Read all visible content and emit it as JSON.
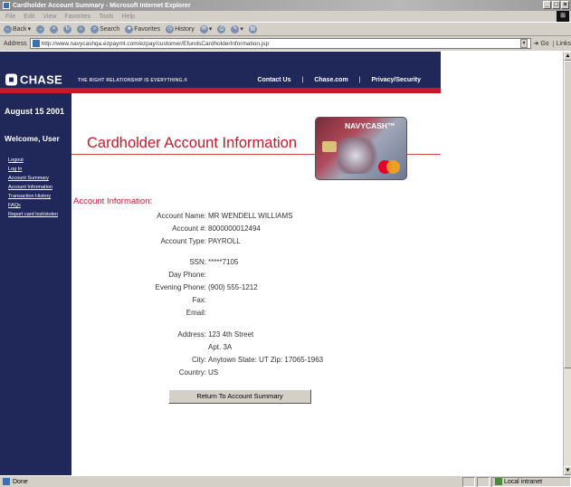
{
  "browser": {
    "title": "Cardholder Account Summary - Microsoft Internet Explorer",
    "menu": [
      "File",
      "Edit",
      "View",
      "Favorites",
      "Tools",
      "Help"
    ],
    "toolbar": {
      "back": "Back",
      "search": "Search",
      "favorites": "Favorites",
      "history": "History"
    },
    "address_label": "Address",
    "address_url": "http://www.navycashqa.ezpaymt.com/ezpay/customer/EfundsCardholderInformation.jsp",
    "go_label": "Go",
    "links_label": "Links",
    "status": "Done",
    "zone": "Local intranet"
  },
  "site": {
    "logo": "CHASE",
    "tagline": "THE RIGHT RELATIONSHIP IS EVERYTHING.®",
    "topnav": [
      "Contact Us",
      "Chase.com",
      "Privacy/Security"
    ],
    "date": "August 15 2001",
    "welcome": "Welcome, User",
    "sidebar_links": [
      "Logout",
      "Log In",
      "Account Summary",
      "Account Information",
      "Transaction History",
      "FAQs",
      "Report card lost/stolen"
    ],
    "card_brand": "NAVYCASH™"
  },
  "page": {
    "title": "Cardholder Account Information",
    "section": "Account Information:",
    "fields": {
      "account_name_label": "Account Name:",
      "account_name": "MR WENDELL WILLIAMS",
      "account_no_label": "Account #:",
      "account_no": "8000000012494",
      "account_type_label": "Account Type:",
      "account_type": "PAYROLL",
      "ssn_label": "SSN:",
      "ssn": "*****7105",
      "day_phone_label": "Day Phone:",
      "day_phone": "",
      "evening_phone_label": "Evening Phone:",
      "evening_phone": "(900) 555-1212",
      "fax_label": "Fax:",
      "fax": "",
      "email_label": "Email:",
      "email": "",
      "address_label": "Address:",
      "address1": "123 4th Street",
      "address2": "Apt. 3A",
      "city_label": "City:",
      "city": "Anytown",
      "state_label": "State:",
      "state": "UT",
      "zip_label": "Zip:",
      "zip": "17065-1963",
      "country_label": "Country:",
      "country": "US"
    },
    "return_button": "Return To Account Summary"
  }
}
